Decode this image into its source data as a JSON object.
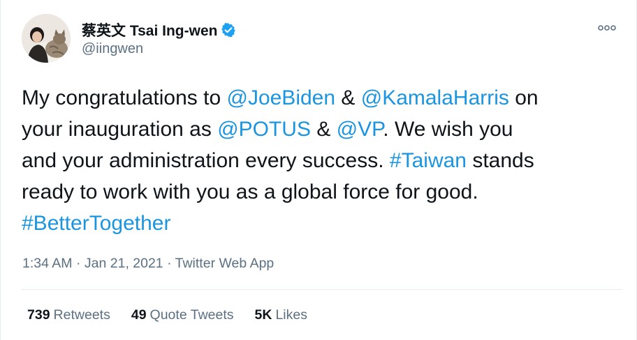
{
  "author": {
    "display_name": "蔡英文 Tsai Ing-wen",
    "handle": "@iingwen",
    "verified": true
  },
  "tweet": {
    "segments": [
      {
        "text": "My congratulations to ",
        "type": "text"
      },
      {
        "text": "@JoeBiden",
        "type": "mention"
      },
      {
        "text": " & ",
        "type": "text"
      },
      {
        "text": "@KamalaHarris",
        "type": "mention"
      },
      {
        "text": " on\nyour inauguration as ",
        "type": "text"
      },
      {
        "text": "@POTUS",
        "type": "mention"
      },
      {
        "text": " & ",
        "type": "text"
      },
      {
        "text": "@VP",
        "type": "mention"
      },
      {
        "text": ". We wish you\nand your administration every success. ",
        "type": "text"
      },
      {
        "text": "#Taiwan",
        "type": "hashtag"
      },
      {
        "text": " stands\nready to work with you as a global force for good.\n",
        "type": "text"
      },
      {
        "text": "#BetterTogether",
        "type": "hashtag"
      }
    ]
  },
  "meta": {
    "time": "1:34 AM",
    "separator": " · ",
    "date": "Jan 21, 2021",
    "source": "Twitter Web App"
  },
  "stats": {
    "retweets": {
      "count": "739",
      "label": "Retweets"
    },
    "quotes": {
      "count": "49",
      "label": "Quote Tweets"
    },
    "likes": {
      "count": "5K",
      "label": "Likes"
    }
  },
  "colors": {
    "link": "#1b95e0",
    "verified": "#1da1f2",
    "secondary": "#5b7083",
    "divider": "#e6ecf0"
  }
}
